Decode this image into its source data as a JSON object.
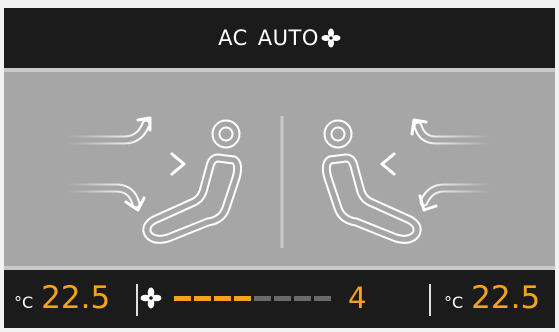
{
  "top_bar": {
    "ac_label": "AC",
    "auto_label": "AUTO",
    "fan_icon": "fan-icon"
  },
  "left_zone": {
    "unit": "°C",
    "temperature": "22.5"
  },
  "right_zone": {
    "unit": "°C",
    "temperature": "22.5"
  },
  "fan": {
    "icon": "fan-icon",
    "level": "4",
    "segments_total": 8,
    "segments_active": 4
  },
  "colors": {
    "accent": "#f7a21c",
    "panel": "#a6a6a6",
    "bar_background": "#1b1b1b",
    "inactive_segment": "#6a6a6a"
  }
}
